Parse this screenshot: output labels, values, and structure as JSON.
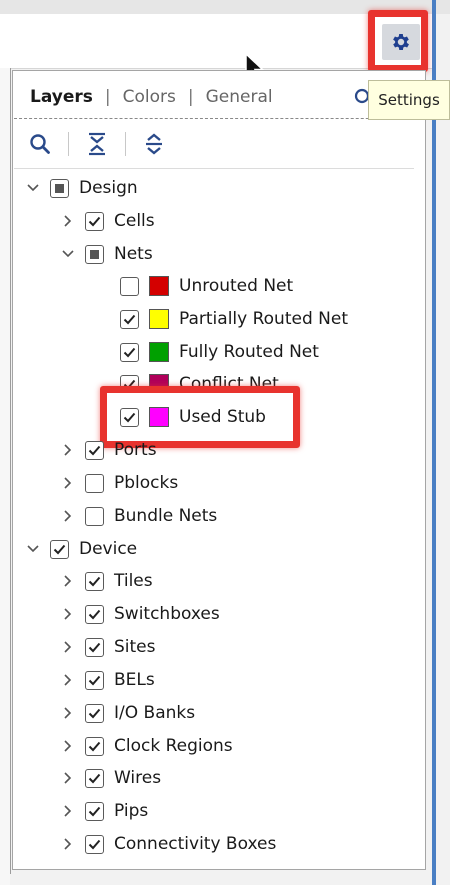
{
  "header": {
    "settings_tooltip": "Settings"
  },
  "tabs": [
    {
      "label": "Layers",
      "active": true
    },
    {
      "label": "Colors",
      "active": false
    },
    {
      "label": "General",
      "active": false
    }
  ],
  "tab_separator": "|",
  "toolbar": {
    "buttons": [
      "search-icon",
      "collapse-all-icon",
      "expand-all-icon"
    ]
  },
  "tree": {
    "design": {
      "label": "Design",
      "cells": "Cells",
      "nets": "Nets",
      "net_items": [
        {
          "label": "Unrouted Net",
          "checked": false,
          "color": "#d40000"
        },
        {
          "label": "Partially Routed Net",
          "checked": true,
          "color": "#ffff00"
        },
        {
          "label": "Fully Routed Net",
          "checked": true,
          "color": "#00a000"
        },
        {
          "label": "Conflict Net",
          "checked": true,
          "color": "#b0005a"
        },
        {
          "label": "Used Stub",
          "checked": true,
          "color": "#ff00ff"
        }
      ],
      "ports": "Ports",
      "pblocks": "Pblocks",
      "bundle_nets": "Bundle Nets"
    },
    "device": {
      "label": "Device",
      "items": [
        "Tiles",
        "Switchboxes",
        "Sites",
        "BELs",
        "I/O Banks",
        "Clock Regions",
        "Wires",
        "Pips",
        "Connectivity Boxes"
      ]
    }
  },
  "colors": {
    "highlight": "#e8332e",
    "accent": "#4a7fc4"
  }
}
